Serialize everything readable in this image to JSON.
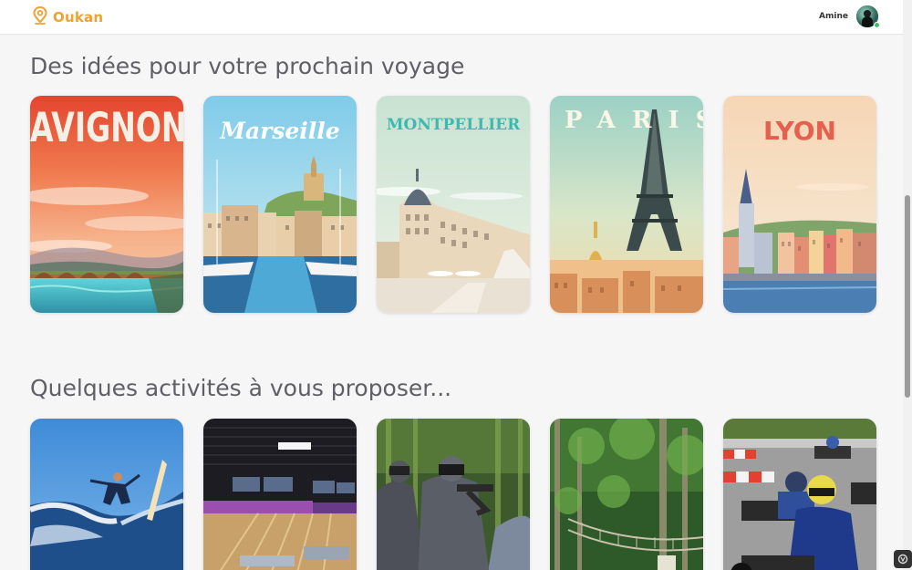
{
  "header": {
    "brand": "Oukan",
    "user_name": "Amine"
  },
  "sections": {
    "travel_title": "Des idées pour votre prochain voyage",
    "activities_title": "Quelques activités à vous proposer..."
  },
  "destinations": [
    {
      "name": "AVIGNON",
      "color": "#f4f0e6"
    },
    {
      "name": "Marseille",
      "color": "#ffffff"
    },
    {
      "name": "MONTPELLIER",
      "color": "#3fb8b0"
    },
    {
      "name": "PARIS",
      "color": "#fbf6e7"
    },
    {
      "name": "LYON",
      "color": "#e5604f"
    }
  ],
  "activities": [
    {
      "icon": "surfing-photo"
    },
    {
      "icon": "bowling-photo"
    },
    {
      "icon": "paintball-photo"
    },
    {
      "icon": "treetop-adventure-photo"
    },
    {
      "icon": "karting-photo"
    }
  ],
  "colors": {
    "brand": "#f0a22e",
    "title": "#5f5f66",
    "online": "#3cc26a"
  }
}
